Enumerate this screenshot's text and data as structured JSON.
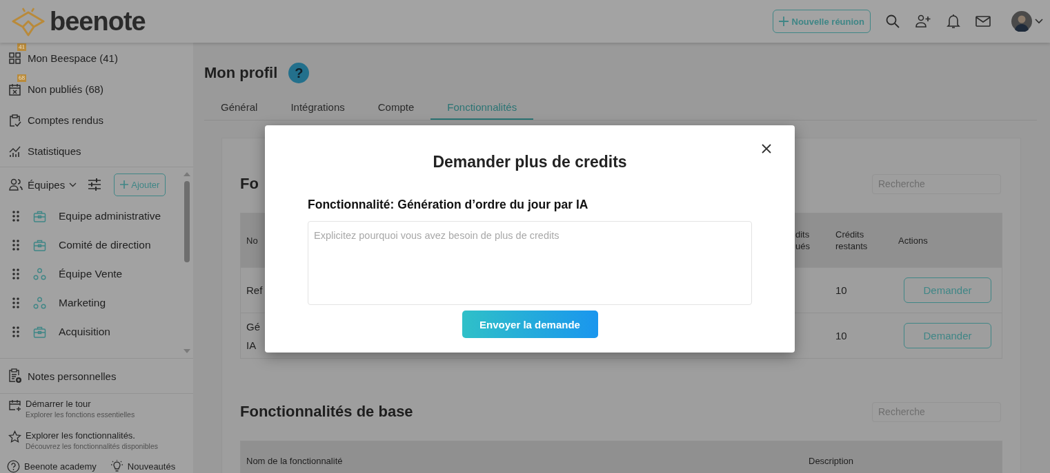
{
  "header": {
    "logo": "beenote",
    "new_meeting_button": "Nouvelle réunion"
  },
  "sidebar": {
    "nav": [
      {
        "label": "Mon Beespace (41)",
        "badge": "41",
        "kind": "grid"
      },
      {
        "label": "Non publiés (68)",
        "badge": "68",
        "kind": "calendar"
      },
      {
        "label": "Comptes rendus",
        "kind": "clipboard"
      },
      {
        "label": "Statistiques",
        "kind": "chart"
      }
    ],
    "teams_header": {
      "label": "Équipes",
      "add_button": "Ajouter"
    },
    "teams": [
      {
        "name": "Equipe administrative",
        "kind": "briefcase"
      },
      {
        "name": "Comité de direction",
        "kind": "briefcase"
      },
      {
        "name": "Équipe Vente",
        "kind": "group"
      },
      {
        "name": "Marketing",
        "kind": "group"
      },
      {
        "name": "Acquisition",
        "kind": "briefcase"
      }
    ],
    "notes": "Notes personnelles",
    "guides": [
      {
        "title": "Démarrer le tour",
        "subtitle": "Explorer les fonctions essentielles",
        "kind": "calendar-plus"
      },
      {
        "title": "Explorer les fonctionnalités.",
        "subtitle": "Découvrez les fonctionnalités disponibles",
        "kind": "star"
      }
    ],
    "footer_links": [
      {
        "label": "Beenote academy",
        "kind": "help"
      },
      {
        "label": "Nouveautés",
        "kind": "bulb"
      }
    ]
  },
  "page": {
    "title": "Mon profil",
    "help": "?"
  },
  "tabs": [
    {
      "label": "Général",
      "selected": false
    },
    {
      "label": "Intégrations",
      "selected": false
    },
    {
      "label": "Compte",
      "selected": false
    },
    {
      "label": "Fonctionnalités",
      "selected": true
    }
  ],
  "sections": [
    {
      "title": "Fo",
      "search_placeholder": "Recherche",
      "columns": [
        "No",
        "dits\nués",
        "Crédits restants",
        "Actions"
      ],
      "rows": [
        {
          "column_1": "Ref",
          "credits_remaining": "10",
          "action": "Demander"
        },
        {
          "column_1": "Gé\nIA",
          "credits_remaining": "10",
          "action": "Demander"
        }
      ]
    },
    {
      "title": "Fonctionnalités de base",
      "search_placeholder": "Recherche",
      "columns": [
        "Nom de la fonctionnalité",
        "Description"
      ]
    }
  ],
  "modal": {
    "title": "Demander plus de credits",
    "label": "Fonctionnalité: Génération d’ordre du jour par IA",
    "placeholder": "Explicitez pourquoi vous avez besoin de plus de credits",
    "submit": "Envoyer la demande"
  }
}
